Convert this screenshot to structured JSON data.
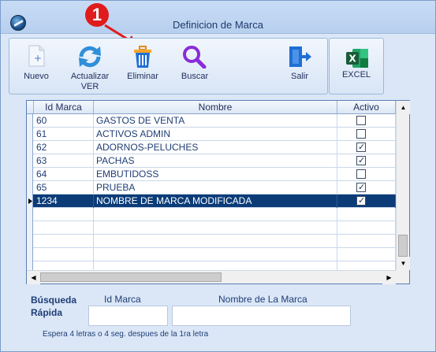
{
  "window": {
    "title": "Definicion de Marca"
  },
  "annotation": {
    "marker": "1"
  },
  "toolbar": {
    "buttons": [
      {
        "label": "Nuevo",
        "icon": "new-document-icon"
      },
      {
        "label": "Actualizar VER",
        "icon": "refresh-icon"
      },
      {
        "label": "Eliminar",
        "icon": "trash-icon"
      },
      {
        "label": "Buscar",
        "icon": "search-icon"
      },
      {
        "label": "Salir",
        "icon": "exit-icon"
      },
      {
        "label": "EXCEL",
        "icon": "excel-icon"
      }
    ]
  },
  "grid": {
    "columns": [
      "Id Marca",
      "Nombre",
      "Activo"
    ],
    "rows": [
      {
        "id": "60",
        "nombre": "GASTOS DE VENTA",
        "activo": false
      },
      {
        "id": "61",
        "nombre": "ACTIVOS ADMIN",
        "activo": false
      },
      {
        "id": "62",
        "nombre": "ADORNOS-PELUCHES",
        "activo": true
      },
      {
        "id": "63",
        "nombre": "PACHAS",
        "activo": true
      },
      {
        "id": "64",
        "nombre": "EMBUTIDOSS",
        "activo": false
      },
      {
        "id": "65",
        "nombre": "PRUEBA",
        "activo": true
      },
      {
        "id": "1234",
        "nombre": "NOMBRE DE MARCA MODIFICADA",
        "activo": true,
        "selected": true
      }
    ],
    "empty_rows": 5
  },
  "search": {
    "title": "Búsqueda Rápida",
    "id_label": "Id Marca",
    "name_label": "Nombre de La Marca",
    "id_value": "",
    "name_value": "",
    "hint": "Espera 4 letras o 4 seg. despues de la 1ra letra"
  },
  "colors": {
    "selected_row": "#0b3c78",
    "accent": "#e01b1b"
  }
}
